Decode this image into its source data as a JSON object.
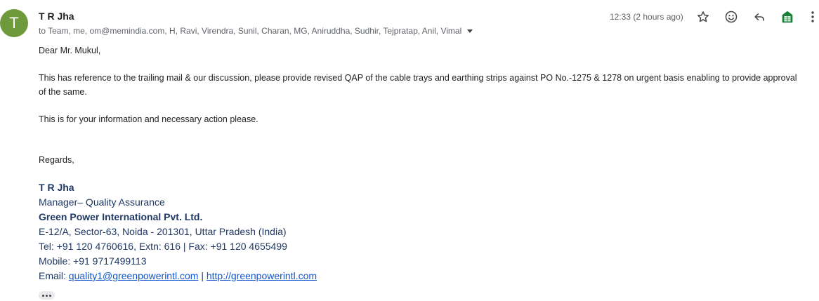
{
  "email": {
    "avatar_letter": "T",
    "sender": "T R Jha",
    "recipients": "to Team, me, om@memindia.com, H, Ravi, Virendra, Sunil, Charan, MG, Aniruddha, Sudhir, Tejpratap, Anil, Vimal",
    "timestamp": "12:33 (2 hours ago)",
    "greeting": "Dear Mr. Mukul,",
    "para1": "This has reference to the trailing mail & our discussion, please provide revised QAP of the cable trays and earthing strips against PO No.-1275 & 1278 on urgent basis enabling to provide approval of the same.",
    "para2": "This is for your information and necessary action please.",
    "regards": "Regards,"
  },
  "signature": {
    "name": "T R Jha",
    "role": "Manager– Quality Assurance",
    "company": "Green Power International Pvt. Ltd.",
    "address": "E-12/A, Sector-63, Noida - 201301, Uttar Pradesh (India)",
    "tel": "Tel: +91 120 4760616, Extn: 616 | Fax: +91 120 4655499",
    "mobile": "Mobile:  +91 9717499113",
    "email_label": "Email: ",
    "email_link": "quality1@greenpowerintl.com",
    "separator": " | ",
    "web_link": "http://greenpowerintl.com"
  },
  "icons": {
    "star": "star-icon",
    "emoji": "emoji-icon",
    "reply": "reply-icon",
    "sheets": "sheets-icon",
    "more": "more-vert-icon",
    "caret": "chevron-down-icon",
    "trimmed": "more-horiz-icon"
  },
  "colors": {
    "avatar": "#6e9a3c",
    "signature_text": "#1f3864",
    "link": "#1155cc",
    "sheets_green": "#188038"
  }
}
